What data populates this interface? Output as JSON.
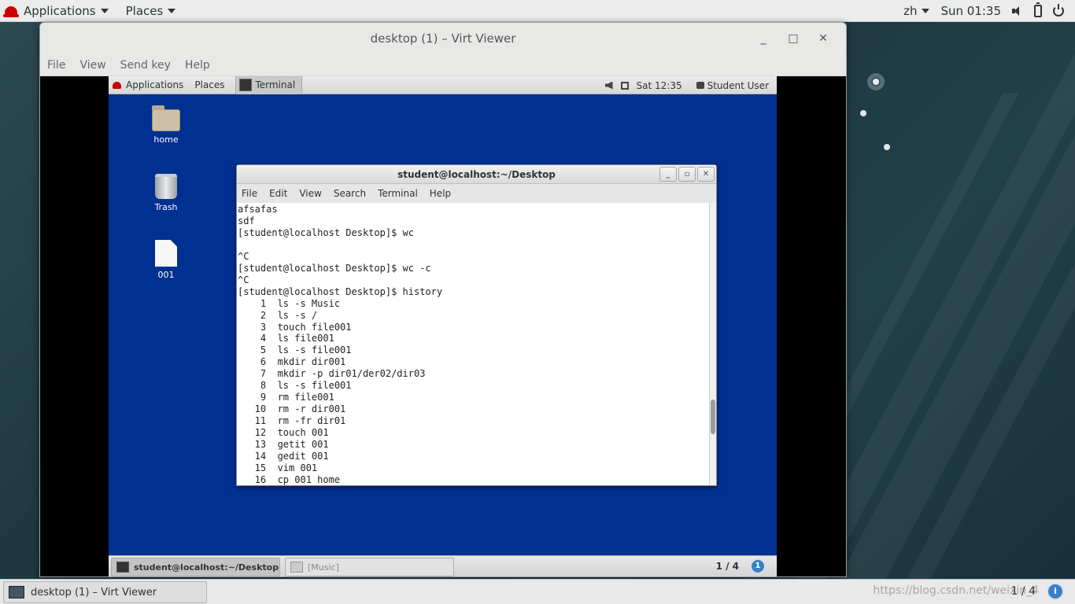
{
  "host": {
    "topbar": {
      "applications": "Applications",
      "places": "Places",
      "lang": "zh",
      "clock": "Sun 01:35"
    },
    "taskbar": {
      "task_label": "desktop (1) – Virt Viewer",
      "workspace": "1 / 4",
      "watermark": "https://blog.csdn.net/weixin_4"
    }
  },
  "viewer": {
    "title": "desktop (1) – Virt Viewer",
    "controls": {
      "minimize": "_",
      "maximize": "□",
      "close": "✕"
    },
    "menu": [
      "File",
      "View",
      "Send key",
      "Help"
    ]
  },
  "guest": {
    "topbar": {
      "applications": "Applications",
      "places": "Places",
      "terminal_task": "Terminal",
      "clock": "Sat 12:35",
      "user": "Student User"
    },
    "desktop_icons": [
      "home",
      "Trash",
      "001"
    ],
    "terminal": {
      "title": "student@localhost:~/Desktop",
      "menu": [
        "File",
        "Edit",
        "View",
        "Search",
        "Terminal",
        "Help"
      ],
      "lines": [
        "afsafas",
        "sdf",
        "[student@localhost Desktop]$ wc",
        "",
        "^C",
        "[student@localhost Desktop]$ wc -c",
        "^C",
        "[student@localhost Desktop]$ history",
        "    1  ls -s Music",
        "    2  ls -s /",
        "    3  touch file001",
        "    4  ls file001",
        "    5  ls -s file001",
        "    6  mkdir dir001",
        "    7  mkdir -p dir01/der02/dir03",
        "    8  ls -s file001",
        "    9  rm file001",
        "   10  rm -r dir001",
        "   11  rm -fr dir01",
        "   12  touch 001",
        "   13  getit 001",
        "   14  gedit 001",
        "   15  vim 001",
        "   16  cp 001 home"
      ]
    },
    "bottom": {
      "task_active": "student@localhost:~/Desktop",
      "task_inactive": "[Music]",
      "workspace": "1 / 4",
      "badge": "1"
    }
  }
}
